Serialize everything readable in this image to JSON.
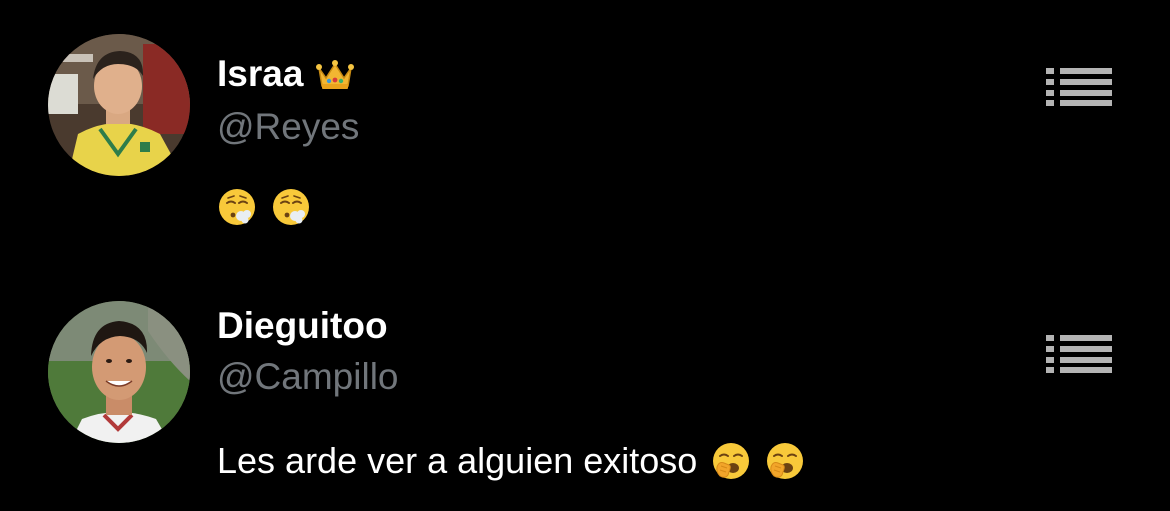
{
  "posts": [
    {
      "display_name": "Israa",
      "badge_icon": "crown-icon",
      "handle": "@Reyes",
      "body_text": "",
      "body_emojis": [
        "face-exhaling-icon",
        "face-exhaling-icon"
      ],
      "menu_icon": "list-icon"
    },
    {
      "display_name": "Dieguitoo",
      "handle": "@Campillo",
      "body_text": "Les arde ver a alguien exitoso",
      "body_emojis": [
        "face-yawning-icon",
        "face-yawning-icon"
      ],
      "menu_icon": "list-icon"
    }
  ],
  "colors": {
    "background": "#000000",
    "name_text": "#ffffff",
    "handle_text": "#71767b",
    "menu_icon": "#b4b4b4"
  }
}
